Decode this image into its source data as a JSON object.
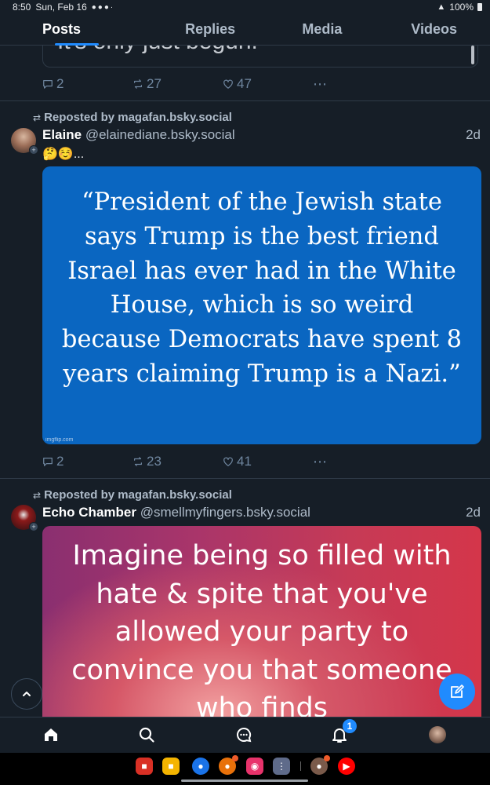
{
  "status_bar": {
    "time": "8:50",
    "date": "Sun, Feb 16",
    "battery": "100%"
  },
  "tabs": [
    {
      "label": "Posts",
      "active": true
    },
    {
      "label": "Replies",
      "active": false
    },
    {
      "label": "Media",
      "active": false
    },
    {
      "label": "Videos",
      "active": false
    }
  ],
  "prev_post": {
    "embed_text": "It's only just begun.",
    "replies": "2",
    "reposts": "27",
    "likes": "47"
  },
  "posts": [
    {
      "repost_label": "Reposted by magafan.bsky.social",
      "author_name": "Elaine",
      "author_handle": "@elainediane.bsky.social",
      "time": "2d",
      "text": "🤔☺️...",
      "image_text": "“President of the Jewish state says Trump is the best friend Israel has ever had in the White House, which is so weird because Democrats have spent 8 years claiming Trump is a Nazi.”",
      "image_watermark": "imgflip.com",
      "replies": "2",
      "reposts": "23",
      "likes": "41"
    },
    {
      "repost_label": "Reposted by magafan.bsky.social",
      "author_name": "Echo Chamber",
      "author_handle": "@smellmyfingers.bsky.social",
      "time": "2d",
      "image_text": "Imagine being so filled with hate & spite that you've allowed your party to convince you that someone who finds"
    }
  ],
  "bottom_nav": {
    "notification_count": "1"
  },
  "colors": {
    "background": "#161e27",
    "accent": "#208bfe",
    "muted": "#6f869f",
    "meme_blue": "#0a66c1"
  },
  "icons": [
    "home-icon",
    "search-icon",
    "chat-icon",
    "bell-icon",
    "compose-icon",
    "chevron-up-icon",
    "reply-icon",
    "repost-icon",
    "like-icon",
    "more-icon"
  ]
}
